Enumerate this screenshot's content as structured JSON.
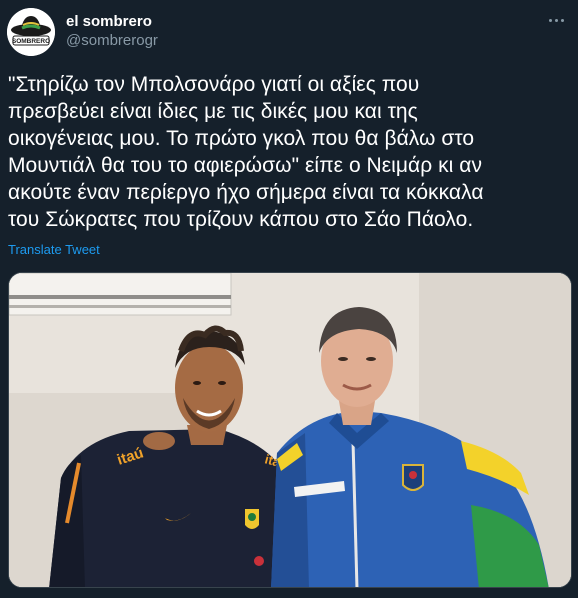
{
  "tweet": {
    "display_name": "el sombrero",
    "handle": "@sombrerogr",
    "text": "\"Στηρίζω τον Μπολσονάρο γιατί οι αξίες που\nπρεσβεύει είναι ίδιες με τις δικές μου και της\nοικογένειας μου. Το πρώτο γκολ που θα βάλω στο\nΜουντιάλ θα του το αφιερώσω\" είπε ο Νειμάρ κι αν\nακούτε έναν περίεργο ήχο σήμερα είναι τα κόκκαλα\nτου Σώκρατες που τρίζουν κάπου στο Σάο Πάολο.",
    "translate_label": "Translate Tweet",
    "avatar_text": "SOMBRERO",
    "more_icon": "more-horizontal-icon"
  },
  "media": {
    "type": "photo",
    "jersey_text": "itaú"
  },
  "colors": {
    "background": "#15202b",
    "primary_text": "#ffffff",
    "secondary_text": "#8899a6",
    "link": "#1d9bf0",
    "border": "#38444d"
  }
}
